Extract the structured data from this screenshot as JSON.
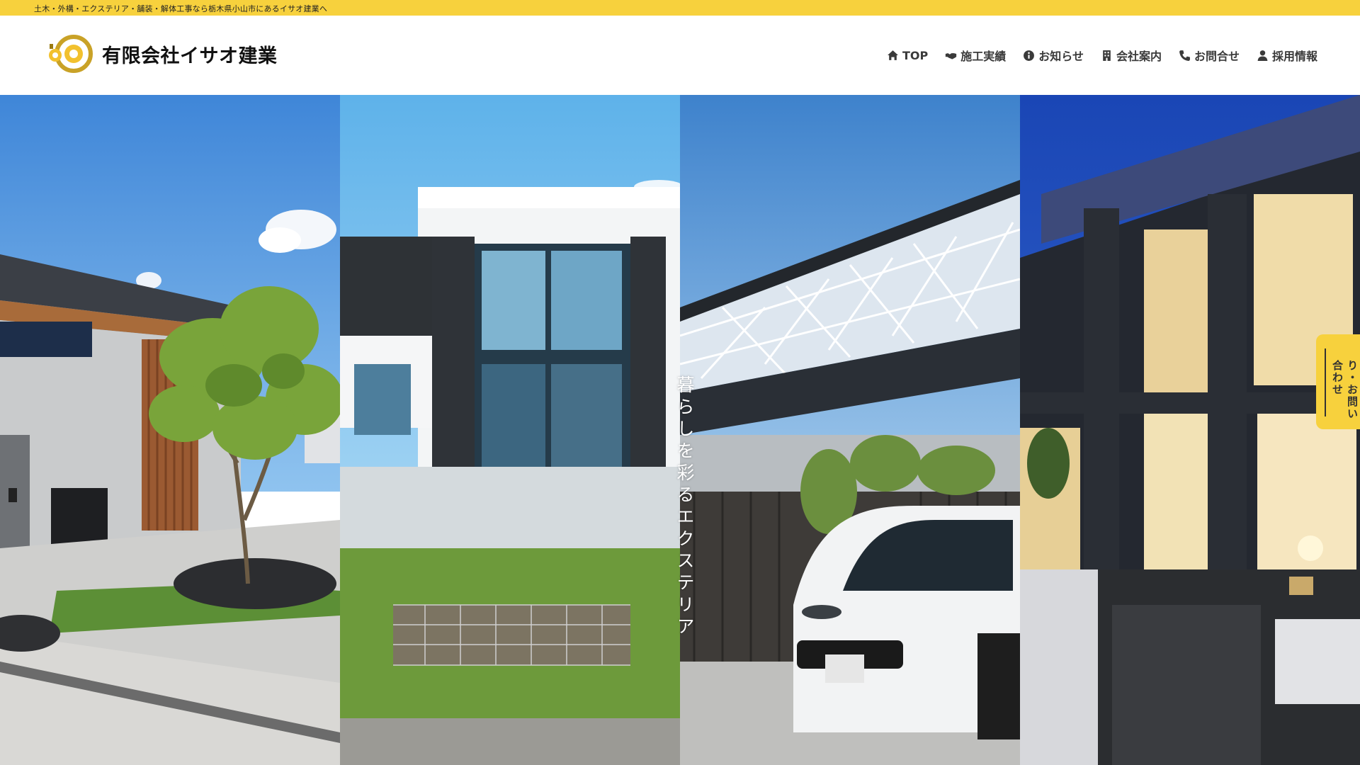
{
  "topbar": {
    "text": "土木・外構・エクステリア・舗装・解体工事なら栃木県小山市にあるイサオ建業へ"
  },
  "header": {
    "logo_text": "有限会社イサオ建業",
    "nav": [
      {
        "label": "TOP",
        "icon": "home-icon"
      },
      {
        "label": "施工実績",
        "icon": "handshake-icon"
      },
      {
        "label": "お知らせ",
        "icon": "info-circle-icon"
      },
      {
        "label": "会社案内",
        "icon": "building-icon"
      },
      {
        "label": "お問合せ",
        "icon": "phone-icon"
      },
      {
        "label": "採用情報",
        "icon": "user-icon"
      }
    ]
  },
  "hero": {
    "tagline": "暮らしを彩るエクステリア",
    "panels": [
      {
        "subject": "house-with-tree-garden"
      },
      {
        "subject": "white-modern-house-lawn"
      },
      {
        "subject": "carport-white-suv"
      },
      {
        "subject": "night-lit-house-entrance"
      }
    ]
  },
  "side_tab": {
    "label": "お見積もり・お問い合わせ"
  },
  "colors": {
    "brand_yellow": "#f7d13d",
    "nav_text": "#3a3a3a"
  }
}
